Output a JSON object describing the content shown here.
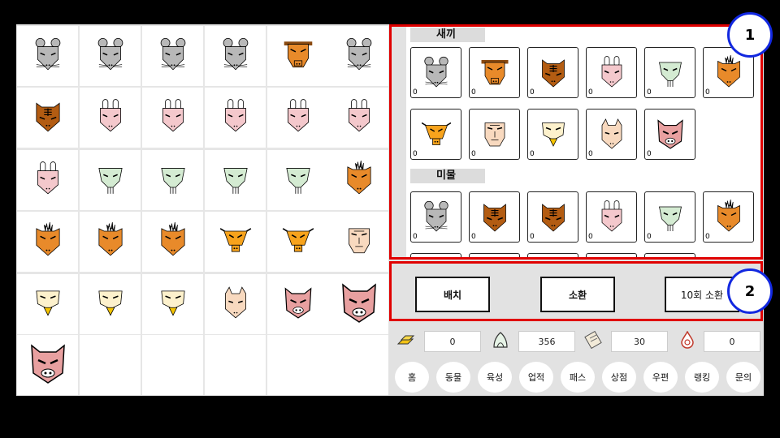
{
  "collection": {
    "section_baby": "새끼",
    "section_adult": "미물",
    "counts": [
      "0",
      "0",
      "0",
      "0",
      "0",
      "0",
      "0",
      "0",
      "0",
      "0",
      "0",
      "0",
      "0",
      "0",
      "0",
      "0",
      "0"
    ]
  },
  "actions": {
    "place_label": "배치",
    "summon_label": "소환",
    "summon10_label": "10회 소환"
  },
  "resources": {
    "gold": "0",
    "leaf": "356",
    "scroll": "30",
    "drop": "0"
  },
  "nav": [
    "홈",
    "동물",
    "육성",
    "업적",
    "패스",
    "상점",
    "우편",
    "랭킹",
    "문의"
  ],
  "callouts": [
    "1",
    "2"
  ],
  "colors": {
    "highlight_border": "#e00000",
    "callout_border": "#1228e0",
    "rat": "#b8b8b8",
    "ox_orange": "#e88a2a",
    "tiger_brown": "#b35c12",
    "rabbit_pink": "#f4c8cc",
    "dragon_green": "#d4ebd2",
    "chick_cream": "#fdf1cc",
    "pig_pink": "#e8a0a0",
    "dog_tan": "#f8d9bf"
  }
}
